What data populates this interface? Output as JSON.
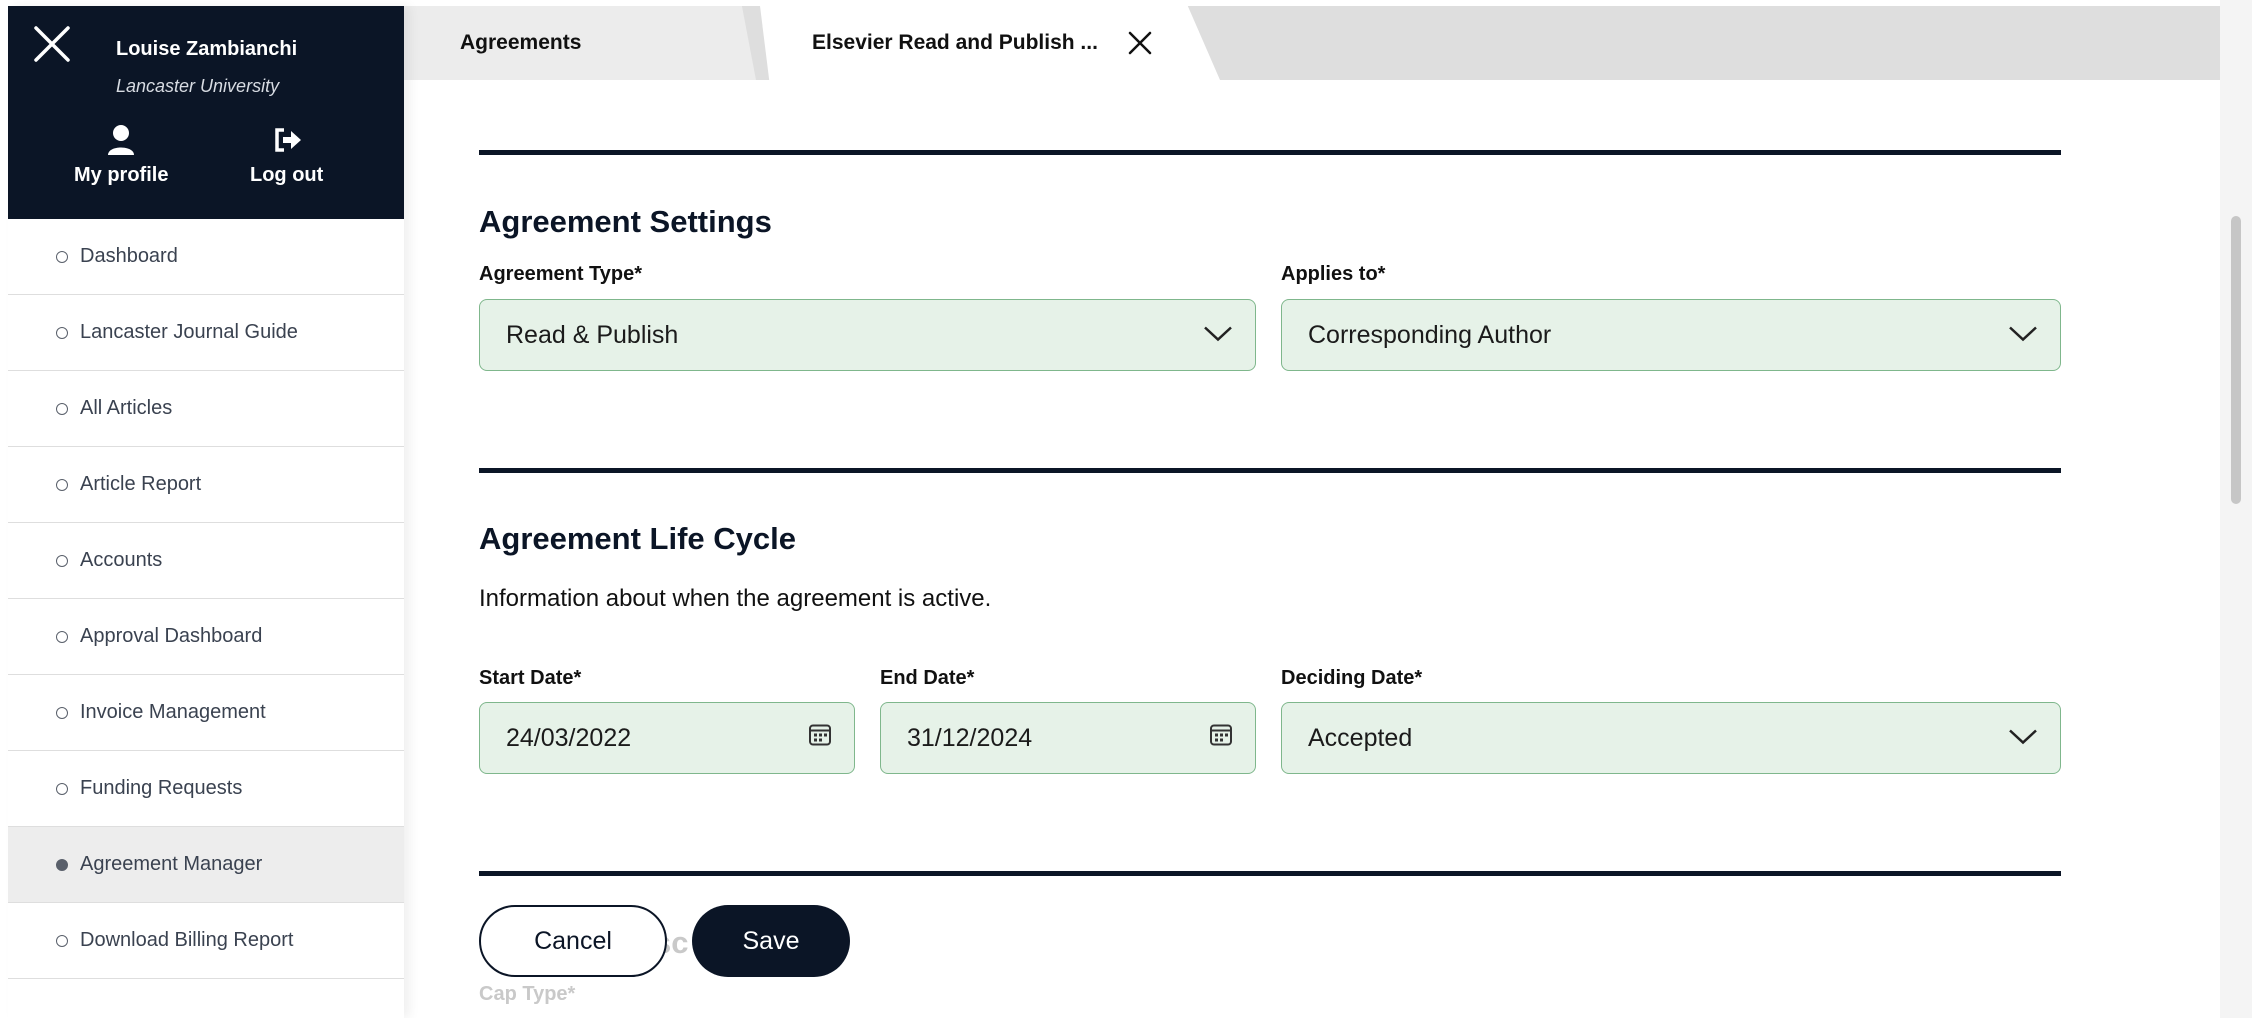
{
  "user": {
    "name": "Louise Zambianchi",
    "organization": "Lancaster University",
    "profile_label": "My profile",
    "logout_label": "Log out"
  },
  "sidebar": {
    "items": [
      {
        "label": "Dashboard",
        "active": false
      },
      {
        "label": "Lancaster Journal Guide",
        "active": false
      },
      {
        "label": "All Articles",
        "active": false
      },
      {
        "label": "Article Report",
        "active": false
      },
      {
        "label": "Accounts",
        "active": false
      },
      {
        "label": "Approval Dashboard",
        "active": false
      },
      {
        "label": "Invoice Management",
        "active": false
      },
      {
        "label": "Funding Requests",
        "active": false
      },
      {
        "label": "Agreement Manager",
        "active": true
      },
      {
        "label": "Download Billing Report",
        "active": false
      }
    ]
  },
  "tabs": [
    {
      "label": "Agreements",
      "active": false
    },
    {
      "label": "Elsevier Read and Publish ...",
      "active": true
    }
  ],
  "settings": {
    "title": "Agreement Settings",
    "type_label": "Agreement Type*",
    "type_value": "Read & Publish",
    "applies_label": "Applies to*",
    "applies_value": "Corresponding Author"
  },
  "lifecycle": {
    "title": "Agreement Life Cycle",
    "description": "Information about when the agreement is active.",
    "start_label": "Start Date*",
    "start_value": "24/03/2022",
    "end_label": "End Date*",
    "end_value": "31/12/2024",
    "deciding_label": "Deciding Date*",
    "deciding_value": "Accepted"
  },
  "actions": {
    "cancel_label": "Cancel",
    "save_label": "Save"
  },
  "partially_hidden": {
    "section_title_fragment": "sc",
    "cap_type_label": "Cap Type*"
  },
  "colors": {
    "navy": "#0b1526",
    "field_bg": "#e6f2e8",
    "field_border": "#7fb78c"
  }
}
